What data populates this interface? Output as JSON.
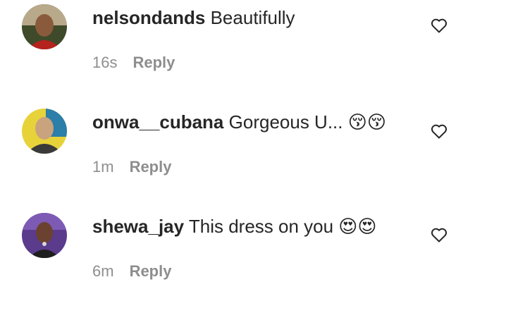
{
  "comments": [
    {
      "username": "nelsondands",
      "text": "Beautifully",
      "time": "16s",
      "reply_label": "Reply",
      "avatar_icon": "avatar-photo"
    },
    {
      "username": "onwa__cubana",
      "text": "Gorgeous U... 😚😚",
      "time": "1m",
      "reply_label": "Reply",
      "avatar_icon": "avatar-photo"
    },
    {
      "username": "shewa_jay",
      "text": "This dress on you 😍😍",
      "time": "6m",
      "reply_label": "Reply",
      "avatar_icon": "avatar-photo"
    }
  ],
  "colors": {
    "text": "#262626",
    "muted": "#8e8e8e",
    "background": "#ffffff"
  },
  "icons": {
    "like": "heart-outline-icon"
  }
}
